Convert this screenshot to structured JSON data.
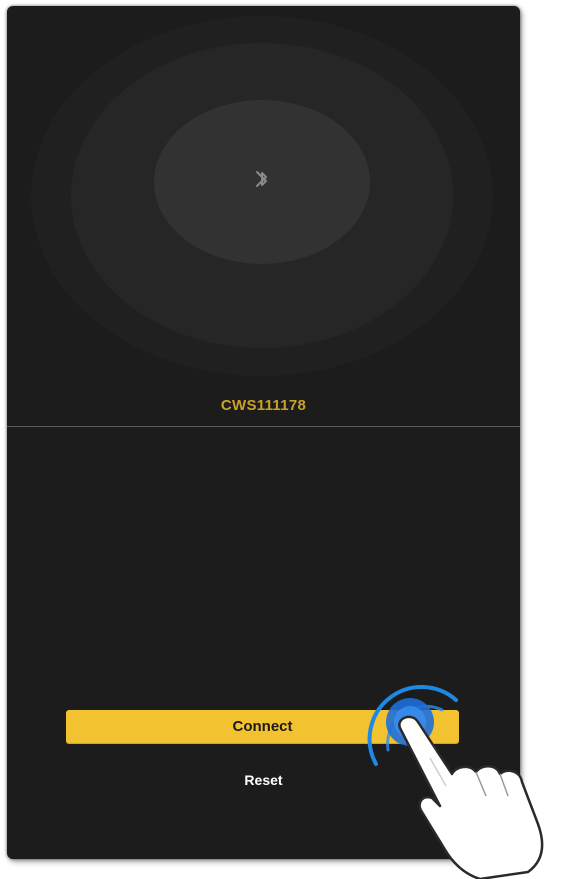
{
  "device": {
    "name": "CWS111178"
  },
  "actions": {
    "connect_label": "Connect",
    "reset_label": "Reset"
  },
  "icons": {
    "center_icon": "bluetooth-icon",
    "overlay": "tap-hand-icon"
  },
  "colors": {
    "background": "#1c1c1c",
    "accent": "#f2c230",
    "device_name": "#c9a227",
    "tap_highlight": "#1e88e5"
  }
}
